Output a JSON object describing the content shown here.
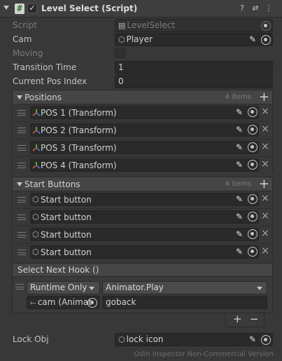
{
  "component": {
    "title": "Level Select (Script)",
    "enabled_check": "✓",
    "hash": "#"
  },
  "header_icons": {
    "help": "?",
    "settings": "⇄",
    "menu": "⋮"
  },
  "fields": {
    "script_label": "Script",
    "script_value": "LevelSelect",
    "cam_label": "Cam",
    "cam_value": "Player",
    "moving_label": "Moving",
    "transition_label": "Transition Time",
    "transition_value": "1",
    "pos_index_label": "Current Pos Index",
    "pos_index_value": "0"
  },
  "positions": {
    "label": "Positions",
    "count": "4 items",
    "plus": "+",
    "items": [
      "POS 1 (Transform)",
      "POS 2 (Transform)",
      "POS 3 (Transform)",
      "POS 4 (Transform)"
    ]
  },
  "start_buttons": {
    "label": "Start Buttons",
    "count": "4 items",
    "plus": "+",
    "items": [
      "Start button",
      "Start button",
      "Start button",
      "Start button"
    ]
  },
  "hook": {
    "label": "Select Next Hook ()",
    "runtime": "Runtime Only",
    "function": "Animator.Play",
    "target": "cam (Animat",
    "argument": "goback",
    "plus": "+",
    "minus": "−"
  },
  "lock": {
    "label": "Lock Obj",
    "value": "lock icon"
  },
  "footer": "Odin Inspector Non-Commercial Version"
}
